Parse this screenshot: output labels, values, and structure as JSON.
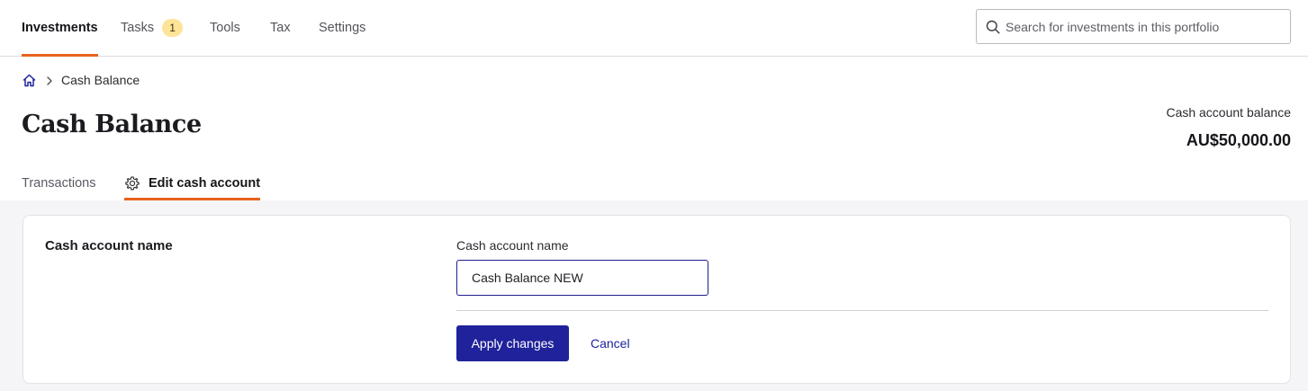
{
  "nav": {
    "items": [
      {
        "label": "Investments",
        "active": true
      },
      {
        "label": "Tasks",
        "badge": "1"
      },
      {
        "label": "Tools"
      },
      {
        "label": "Tax"
      },
      {
        "label": "Settings"
      }
    ]
  },
  "search": {
    "placeholder": "Search for investments in this portfolio",
    "icon": "search-icon"
  },
  "breadcrumb": {
    "home_icon": "home-icon",
    "current": "Cash Balance"
  },
  "page": {
    "title": "Cash Balance",
    "balance_label": "Cash account balance",
    "balance_value": "AU$50,000.00"
  },
  "subtabs": [
    {
      "label": "Transactions"
    },
    {
      "label": "Edit cash account",
      "icon": "gear-icon",
      "active": true
    }
  ],
  "form": {
    "section_heading": "Cash account name",
    "field_label": "Cash account name",
    "field_value": "Cash Balance NEW",
    "apply_label": "Apply changes",
    "cancel_label": "Cancel"
  },
  "colors": {
    "accent": "#e8621f",
    "primary": "#1f229a",
    "badge": "#fde49a"
  }
}
